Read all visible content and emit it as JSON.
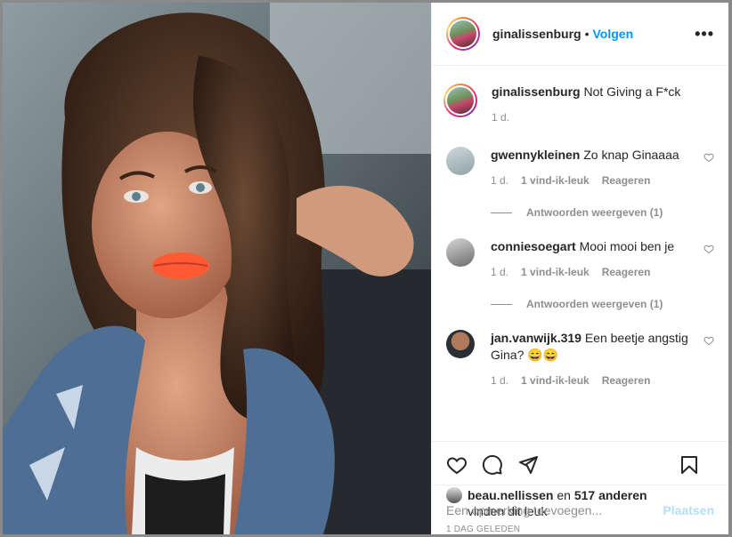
{
  "post": {
    "username": "ginalissenburg",
    "follow_label": "Volgen",
    "dot": "•",
    "more_label": "•••"
  },
  "caption": {
    "username": "ginalissenburg",
    "text": "Not Giving a F*ck",
    "time": "1 d."
  },
  "comments": [
    {
      "username": "gwennykleinen",
      "text": "Zo knap Ginaaaa",
      "time": "1 d.",
      "likes": "1 vind-ik-leuk",
      "reply": "Reageren",
      "view_replies": "Antwoorden weergeven (1)",
      "avatar_color": "#b9c7c9"
    },
    {
      "username": "conniesoegart",
      "text": "Mooi mooi ben je",
      "time": "1 d.",
      "likes": "1 vind-ik-leuk",
      "reply": "Reageren",
      "view_replies": "Antwoorden weergeven (1)",
      "avatar_color": "#9aa0a6"
    },
    {
      "username": "jan.vanwijk.319",
      "text": "Een beetje angstig Gina? 😄😄",
      "time": "1 d.",
      "likes": "1 vind-ik-leuk",
      "reply": "Reageren",
      "avatar_color": "#5a4a3a"
    }
  ],
  "likes": {
    "user": "beau.nellissen",
    "and": "en",
    "others": "517 anderen",
    "suffix": "vinden dit leuk"
  },
  "date_label": "1 DAG GELEDEN",
  "compose": {
    "placeholder": "Een opmerking toevoegen...",
    "post_label": "Plaatsen"
  },
  "colors": {
    "accent": "#0095f6",
    "post_disabled": "#b2dffc",
    "secondary_text": "#8e8e8e"
  },
  "icons": [
    "heart-icon",
    "comment-icon",
    "share-icon",
    "bookmark-icon",
    "more-icon"
  ]
}
